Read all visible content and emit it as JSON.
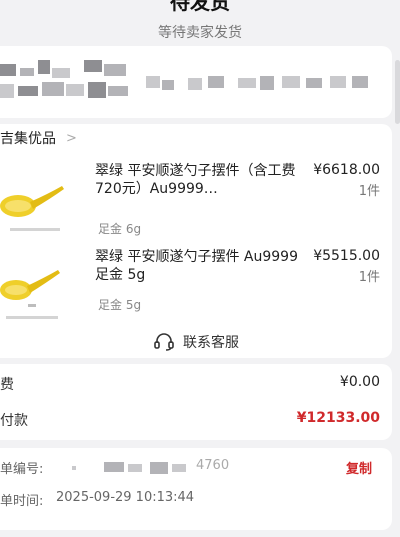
{
  "header": {
    "status_title": "待发货",
    "status_subtitle": "等待卖家发货"
  },
  "shop": {
    "name": "吉集优品",
    "arrow": ">"
  },
  "items": [
    {
      "title": "翠绿 平安顺遂勺子摆件（含工费720元）Au9999…",
      "spec": "足金 6g",
      "price": "¥6618.00",
      "qty": "1件"
    },
    {
      "title": "翠绿 平安顺遂勺子摆件 Au9999 足金 5g",
      "spec": "足金 5g",
      "price": "¥5515.00",
      "qty": "1件"
    }
  ],
  "service": {
    "label": "联系客服",
    "icon": "headset-icon"
  },
  "amounts": {
    "fee_label": "费",
    "fee_value": "¥0.00",
    "paid_label": "付款",
    "paid_value": "¥12133.00"
  },
  "order_info": {
    "number_label": "单编号:",
    "number_value": "4760",
    "copy_label": "复制",
    "time_label": "单时间:",
    "time_value": "2025-09-29 10:13:44"
  },
  "colors": {
    "accent_red": "#d0292b",
    "gold": "#e8c21a"
  }
}
